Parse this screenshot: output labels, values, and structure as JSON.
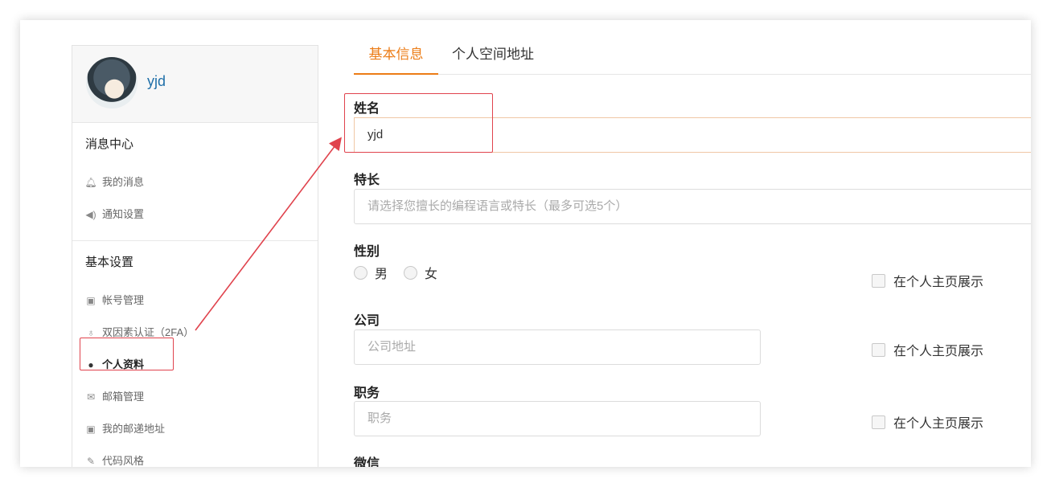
{
  "profile": {
    "username": "yjd"
  },
  "sidebar": {
    "sections": [
      {
        "title": "消息中心",
        "items": [
          {
            "label": "我的消息",
            "icon": "bell-icon"
          },
          {
            "label": "通知设置",
            "icon": "speaker-icon"
          }
        ]
      },
      {
        "title": "基本设置",
        "items": [
          {
            "label": "帐号管理",
            "icon": "id-card-icon"
          },
          {
            "label": "双因素认证（2FA）",
            "icon": "user-key-icon"
          },
          {
            "label": "个人资料",
            "icon": "user-icon",
            "active": true
          },
          {
            "label": "邮箱管理",
            "icon": "envelope-icon"
          },
          {
            "label": "我的邮递地址",
            "icon": "address-card-icon"
          },
          {
            "label": "代码风格",
            "icon": "brush-icon"
          }
        ]
      }
    ]
  },
  "tabs": [
    {
      "label": "基本信息",
      "active": true
    },
    {
      "label": "个人空间地址",
      "active": false
    }
  ],
  "form": {
    "name": {
      "label": "姓名",
      "value": "yjd"
    },
    "specialty": {
      "label": "特长",
      "placeholder": "请选择您擅长的编程语言或特长（最多可选5个）"
    },
    "gender": {
      "label": "性别",
      "options": [
        "男",
        "女"
      ]
    },
    "company": {
      "label": "公司",
      "placeholder": "公司地址"
    },
    "position": {
      "label": "职务",
      "placeholder": "职务"
    },
    "wechat": {
      "label": "微信"
    },
    "show_on_homepage": "在个人主页展示"
  },
  "colors": {
    "accent": "#ec7c16",
    "highlight": "#e0434d",
    "link": "#1f6fa8"
  }
}
